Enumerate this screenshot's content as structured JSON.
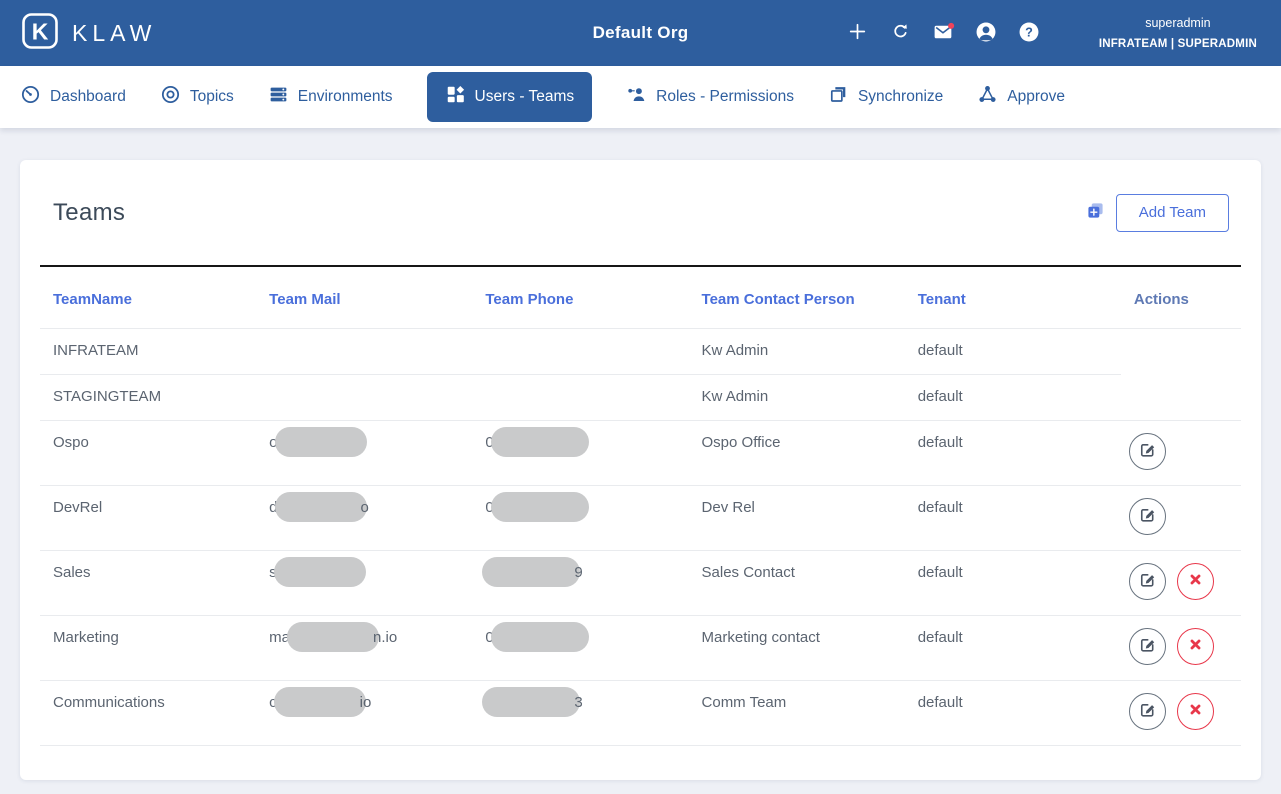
{
  "header": {
    "logo_text": "KLAW",
    "title": "Default Org",
    "icon_buttons": [
      {
        "name": "add-icon"
      },
      {
        "name": "refresh-icon"
      },
      {
        "name": "mail-icon",
        "badge": true
      },
      {
        "name": "account-icon"
      },
      {
        "name": "help-icon"
      }
    ],
    "username": "superadmin",
    "user_role": "INFRATEAM | SUPERADMIN"
  },
  "nav": {
    "tabs": [
      {
        "label": "Dashboard",
        "icon": "dashboard-icon",
        "active": false
      },
      {
        "label": "Topics",
        "icon": "topics-icon",
        "active": false
      },
      {
        "label": "Environments",
        "icon": "environments-icon",
        "active": false
      },
      {
        "label": "Users - Teams",
        "icon": "users-teams-icon",
        "active": true
      },
      {
        "label": "Roles - Permissions",
        "icon": "roles-permissions-icon",
        "active": false
      },
      {
        "label": "Synchronize",
        "icon": "synchronize-icon",
        "active": false
      },
      {
        "label": "Approve",
        "icon": "approve-icon",
        "active": false
      }
    ]
  },
  "main": {
    "title": "Teams",
    "add_team_label": "Add Team",
    "table": {
      "columns": [
        "TeamName",
        "Team Mail",
        "Team Phone",
        "Team Contact Person",
        "Tenant",
        "Actions"
      ],
      "rows": [
        {
          "team_name": "INFRATEAM",
          "mail_prefix": "",
          "mail_redacted": false,
          "mail_suffix": "",
          "phone_prefix": "",
          "phone_redacted": false,
          "phone_suffix": "",
          "contact_person": "Kw Admin",
          "tenant": "default",
          "can_edit": false,
          "can_delete": false
        },
        {
          "team_name": "STAGINGTEAM",
          "mail_prefix": "",
          "mail_redacted": false,
          "mail_suffix": "",
          "phone_prefix": "",
          "phone_redacted": false,
          "phone_suffix": "",
          "contact_person": "Kw Admin",
          "tenant": "default",
          "can_edit": false,
          "can_delete": false
        },
        {
          "team_name": "Ospo",
          "mail_prefix": "o",
          "mail_redacted": true,
          "mail_suffix": "",
          "phone_prefix": "0",
          "phone_redacted": true,
          "phone_suffix": "",
          "contact_person": "Ospo Office",
          "tenant": "default",
          "can_edit": true,
          "can_delete": false
        },
        {
          "team_name": "DevRel",
          "mail_prefix": "d",
          "mail_redacted": true,
          "mail_suffix": "o",
          "phone_prefix": "0",
          "phone_redacted": true,
          "phone_suffix": "",
          "contact_person": "Dev Rel",
          "tenant": "default",
          "can_edit": true,
          "can_delete": false
        },
        {
          "team_name": "Sales",
          "mail_prefix": "s",
          "mail_redacted": true,
          "mail_suffix": "",
          "phone_prefix": "",
          "phone_redacted": true,
          "phone_suffix": "9",
          "contact_person": "Sales Contact",
          "tenant": "default",
          "can_edit": true,
          "can_delete": true
        },
        {
          "team_name": "Marketing",
          "mail_prefix": "ma",
          "mail_redacted": true,
          "mail_suffix": "n.io",
          "phone_prefix": "0",
          "phone_redacted": true,
          "phone_suffix": "",
          "contact_person": "Marketing contact",
          "tenant": "default",
          "can_edit": true,
          "can_delete": true
        },
        {
          "team_name": "Communications",
          "mail_prefix": "c",
          "mail_redacted": true,
          "mail_suffix": "io",
          "phone_prefix": "",
          "phone_redacted": true,
          "phone_suffix": "3",
          "contact_person": "Comm Team",
          "tenant": "default",
          "can_edit": true,
          "can_delete": true
        }
      ]
    }
  },
  "colors": {
    "header_blue": "#2e5e9e",
    "accent_blue": "#4a6fdb",
    "danger_red": "#e8374a",
    "redaction_gray": "#c9cacb"
  }
}
